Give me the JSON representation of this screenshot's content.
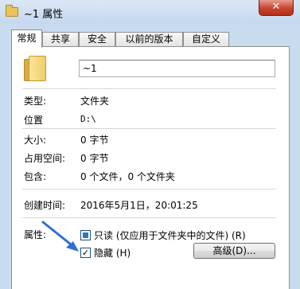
{
  "window": {
    "title": "~1 属性",
    "close": "✕"
  },
  "tabs": [
    "常规",
    "共享",
    "安全",
    "以前的版本",
    "自定义"
  ],
  "general": {
    "name_value": "~1",
    "type_label": "类型:",
    "type_value": "文件夹",
    "location_label": "位置",
    "location_value": "D:\\",
    "size_label": "大小:",
    "size_value": "0 字节",
    "size_on_disk_label": "占用空间:",
    "size_on_disk_value": "0 字节",
    "contains_label": "包含:",
    "contains_value": "0 个文件，0 个文件夹",
    "created_label": "创建时间:",
    "created_value": "2016年5月1日，20:01:25",
    "attributes_label": "属性:",
    "readonly_label": "只读 (仅应用于文件夹中的文件) (R)",
    "readonly_state": "partial",
    "hidden_label": "隐藏 (H)",
    "hidden_checked": "✓",
    "advanced_button": "高级(D)..."
  },
  "colors": {
    "accent_arrow": "#2f6fd6",
    "close_button": "#c7432f",
    "window_frame": "#c9dbef"
  },
  "icons": [
    "folder-icon",
    "close-icon",
    "checkbox-partial-icon",
    "checkbox-checked-icon",
    "annotation-arrow-icon"
  ]
}
